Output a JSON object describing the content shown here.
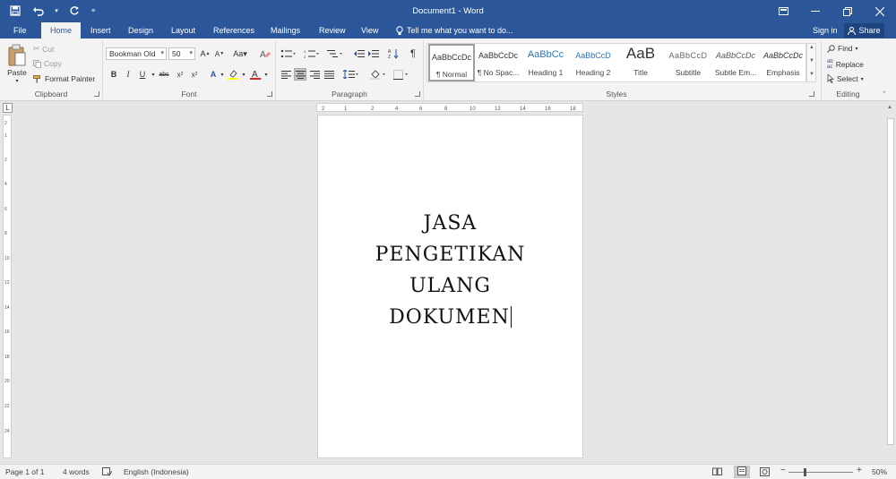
{
  "window": {
    "title": "Document1 - Word"
  },
  "tabs": [
    "File",
    "Home",
    "Insert",
    "Design",
    "Layout",
    "References",
    "Mailings",
    "Review",
    "View"
  ],
  "tell_me": "Tell me what you want to do...",
  "sign_in": "Sign in",
  "share": "Share",
  "clipboard": {
    "paste": "Paste",
    "cut": "Cut",
    "copy": "Copy",
    "format_painter": "Format Painter",
    "label": "Clipboard"
  },
  "font": {
    "name": "Bookman Old",
    "size": "50",
    "label": "Font"
  },
  "paragraph": {
    "label": "Paragraph"
  },
  "styles": {
    "label": "Styles",
    "items": [
      {
        "preview": "AaBbCcDc",
        "name": "¶ Normal"
      },
      {
        "preview": "AaBbCcDc",
        "name": "¶ No Spac..."
      },
      {
        "preview": "AaBbCc",
        "name": "Heading 1"
      },
      {
        "preview": "AaBbCcD",
        "name": "Heading 2"
      },
      {
        "preview": "AaB",
        "name": "Title"
      },
      {
        "preview": "AaBbCcD",
        "name": "Subtitle"
      },
      {
        "preview": "AaBbCcDc",
        "name": "Subtle Em..."
      },
      {
        "preview": "AaBbCcDc",
        "name": "Emphasis"
      }
    ]
  },
  "editing": {
    "find": "Find",
    "replace": "Replace",
    "select": "Select",
    "label": "Editing"
  },
  "document": {
    "lines": [
      "JASA",
      "PENGETIKAN",
      "ULANG",
      "DOKUMEN"
    ]
  },
  "ruler": {
    "h_ticks": [
      "2",
      "1",
      "2",
      "4",
      "6",
      "8",
      "10",
      "12",
      "14",
      "16",
      "18"
    ],
    "v_ticks": [
      "2",
      "1",
      "2",
      "4",
      "6",
      "8",
      "10",
      "12",
      "14",
      "16",
      "18",
      "20",
      "22",
      "24"
    ]
  },
  "status": {
    "page": "Page 1 of 1",
    "words": "4 words",
    "language": "English (Indonesia)",
    "zoom": "50%"
  },
  "colors": {
    "accent": "#2b579a",
    "ribbon": "#f3f3f3",
    "workspace": "#e6e6e6"
  }
}
